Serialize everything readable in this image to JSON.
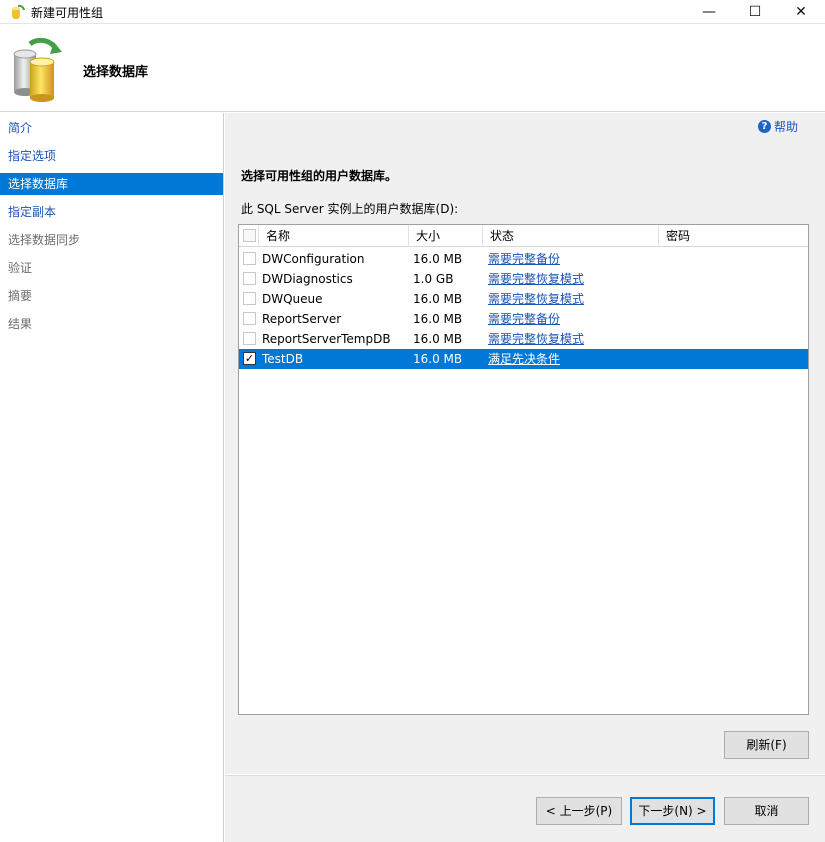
{
  "window": {
    "title": "新建可用性组",
    "controls": {
      "minimize": "—",
      "maximize": "☐",
      "close": "✕"
    }
  },
  "header": {
    "page_title": "选择数据库"
  },
  "sidebar": {
    "items": [
      {
        "label": "简介",
        "state": "link"
      },
      {
        "label": "指定选项",
        "state": "link"
      },
      {
        "label": "选择数据库",
        "state": "selected"
      },
      {
        "label": "指定副本",
        "state": "link"
      },
      {
        "label": "选择数据同步",
        "state": "disabled"
      },
      {
        "label": "验证",
        "state": "disabled"
      },
      {
        "label": "摘要",
        "state": "disabled"
      },
      {
        "label": "结果",
        "state": "disabled"
      }
    ]
  },
  "main": {
    "help_label": "帮助",
    "instruction": "选择可用性组的用户数据库。",
    "list_label": "此 SQL Server 实例上的用户数据库(D):",
    "columns": [
      "名称",
      "大小",
      "状态",
      "密码"
    ],
    "rows": [
      {
        "name": "DWConfiguration",
        "size": "16.0 MB",
        "status": "需要完整备份",
        "checked": false,
        "selected": false
      },
      {
        "name": "DWDiagnostics",
        "size": "1.0 GB",
        "status": "需要完整恢复模式",
        "checked": false,
        "selected": false
      },
      {
        "name": "DWQueue",
        "size": "16.0 MB",
        "status": "需要完整恢复模式",
        "checked": false,
        "selected": false
      },
      {
        "name": "ReportServer",
        "size": "16.0 MB",
        "status": "需要完整备份",
        "checked": false,
        "selected": false
      },
      {
        "name": "ReportServerTempDB",
        "size": "16.0 MB",
        "status": "需要完整恢复模式",
        "checked": false,
        "selected": false
      },
      {
        "name": "TestDB",
        "size": "16.0 MB",
        "status": "满足先决条件",
        "checked": true,
        "selected": true
      }
    ],
    "refresh_label": "刷新(F)"
  },
  "footer": {
    "back_label": "< 上一步(P)",
    "next_label": "下一步(N) >",
    "cancel_label": "取消"
  },
  "colors": {
    "accent": "#0078d7",
    "link": "#1a54b4",
    "panel": "#f0f0f0"
  }
}
